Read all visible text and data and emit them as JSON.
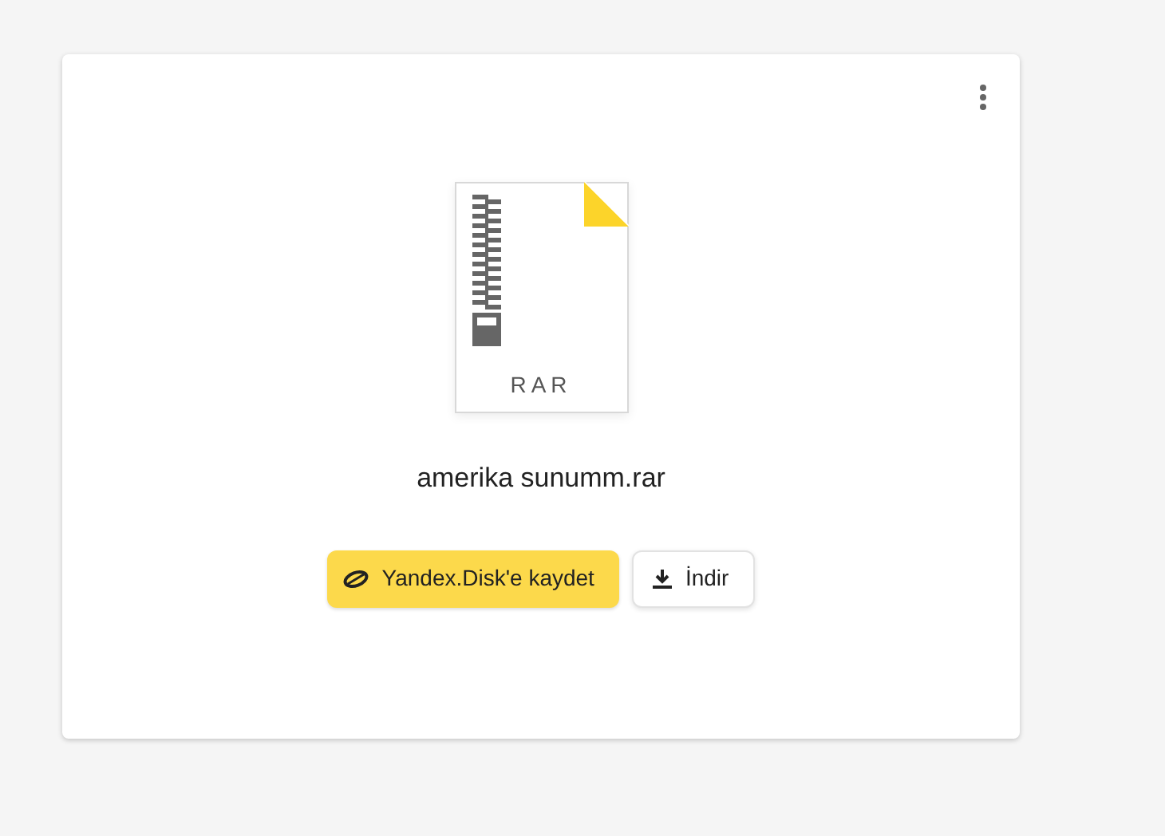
{
  "file": {
    "type_label": "RAR",
    "name": "amerika sunumm.rar"
  },
  "buttons": [
    {
      "kind": "save",
      "label": "Yandex.Disk'e kaydet"
    },
    {
      "kind": "download",
      "label": "İndir"
    }
  ]
}
